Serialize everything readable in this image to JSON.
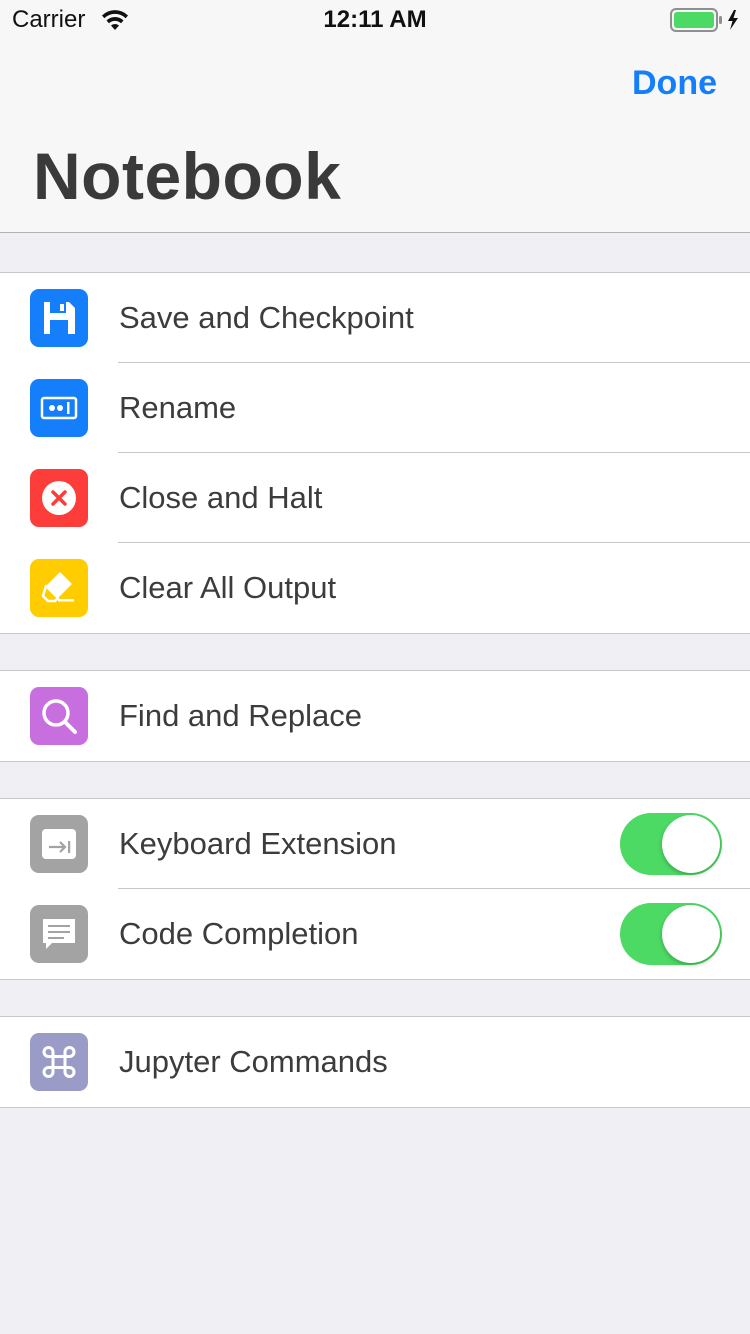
{
  "status_bar": {
    "carrier": "Carrier",
    "time": "12:11 AM",
    "battery_color": "#4cd964"
  },
  "nav": {
    "done_label": "Done",
    "title": "Notebook"
  },
  "groups": [
    {
      "items": [
        {
          "label": "Save and Checkpoint",
          "icon": "save-icon",
          "icon_color": "#147efb"
        },
        {
          "label": "Rename",
          "icon": "rename-icon",
          "icon_color": "#147efb"
        },
        {
          "label": "Close and Halt",
          "icon": "close-halt-icon",
          "icon_color": "#fc3d39"
        },
        {
          "label": "Clear All Output",
          "icon": "eraser-icon",
          "icon_color": "#ffcc00"
        }
      ]
    },
    {
      "items": [
        {
          "label": "Find and Replace",
          "icon": "search-icon",
          "icon_color": "#c86fe0"
        }
      ]
    },
    {
      "items": [
        {
          "label": "Keyboard Extension",
          "icon": "keyboard-tab-icon",
          "icon_color": "#a3a3a3",
          "toggle_on": true
        },
        {
          "label": "Code Completion",
          "icon": "message-icon",
          "icon_color": "#a3a3a3",
          "toggle_on": true
        }
      ]
    },
    {
      "items": [
        {
          "label": "Jupyter Commands",
          "icon": "command-icon",
          "icon_color": "#9a9cc7"
        }
      ]
    }
  ],
  "colors": {
    "accent": "#147efb",
    "toggle_on": "#4cd964",
    "background": "#efeff4"
  }
}
